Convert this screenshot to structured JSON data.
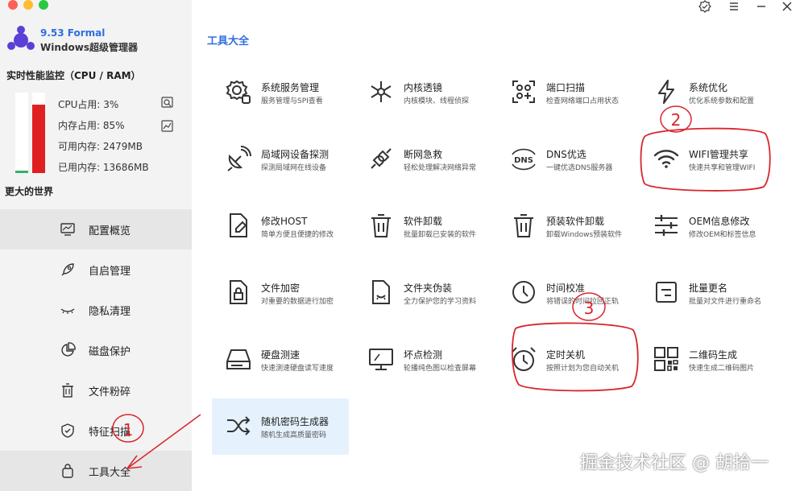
{
  "app": {
    "version": "9.53 Formal",
    "name": "Windows超级管理器"
  },
  "monitor": {
    "title": "实时性能监控（CPU / RAM）",
    "cpu_label": "CPU占用: 3%",
    "mem_label": "内存占用: 85%",
    "avail_label": "可用内存: 2479MB",
    "used_label": "已用内存: 13686MB",
    "cpu_percent": 3,
    "mem_percent": 85
  },
  "world_label": "更大的世界",
  "menu": [
    {
      "label": "配置概览",
      "icon": "monitor-chart-icon"
    },
    {
      "label": "自启管理",
      "icon": "rocket-icon"
    },
    {
      "label": "隐私清理",
      "icon": "eye-closed-icon"
    },
    {
      "label": "磁盘保护",
      "icon": "pie-chart-icon"
    },
    {
      "label": "文件粉碎",
      "icon": "trash-icon"
    },
    {
      "label": "特征扫描",
      "icon": "shield-check-icon"
    },
    {
      "label": "工具大全",
      "icon": "bag-icon"
    }
  ],
  "section_title": "工具大全",
  "tools": [
    {
      "name": "系统服务管理",
      "desc": "服务管理与SPI查看"
    },
    {
      "name": "内核透镜",
      "desc": "内核模块、线程侦探"
    },
    {
      "name": "端口扫描",
      "desc": "检查网络端口占用状态"
    },
    {
      "name": "系统优化",
      "desc": "优化系统参数和配置"
    },
    {
      "name": "局域网设备探测",
      "desc": "探测局域网在线设备"
    },
    {
      "name": "断网急救",
      "desc": "轻松处理解决网络异常"
    },
    {
      "name": "DNS优选",
      "desc": "一键优选DNS服务器"
    },
    {
      "name": "WIFI管理共享",
      "desc": "快速共享和管理WIFI"
    },
    {
      "name": "修改HOST",
      "desc": "简单方便且便捷的修改"
    },
    {
      "name": "软件卸载",
      "desc": "批量卸载已安装的软件"
    },
    {
      "name": "预装软件卸载",
      "desc": "卸载Windows预装软件"
    },
    {
      "name": "OEM信息修改",
      "desc": "修改OEM和标签信息"
    },
    {
      "name": "文件加密",
      "desc": "对重要的数据进行加密"
    },
    {
      "name": "文件夹伪装",
      "desc": "全力保护您的学习资料"
    },
    {
      "name": "时间校准",
      "desc": "将错误的时间拉回正轨"
    },
    {
      "name": "批量更名",
      "desc": "批量对文件进行重命名"
    },
    {
      "name": "硬盘测速",
      "desc": "快速测速硬盘读写速度"
    },
    {
      "name": "坏点检测",
      "desc": "轮播纯色图以检查屏幕"
    },
    {
      "name": "定时关机",
      "desc": "按照计划为您自动关机"
    },
    {
      "name": "二维码生成",
      "desc": "快速生成二维码图片"
    },
    {
      "name": "随机密码生成器",
      "desc": "随机生成高质量密码"
    }
  ],
  "annotations": [
    "1",
    "2",
    "3"
  ],
  "watermark": "掘金技术社区 @ 胡拾一",
  "colors": {
    "accent": "#2f6fe0",
    "cpu_bar": "#2fb36a",
    "mem_bar": "#e02020",
    "annotation": "#d8262c",
    "highlight": "#e5f2fd"
  }
}
